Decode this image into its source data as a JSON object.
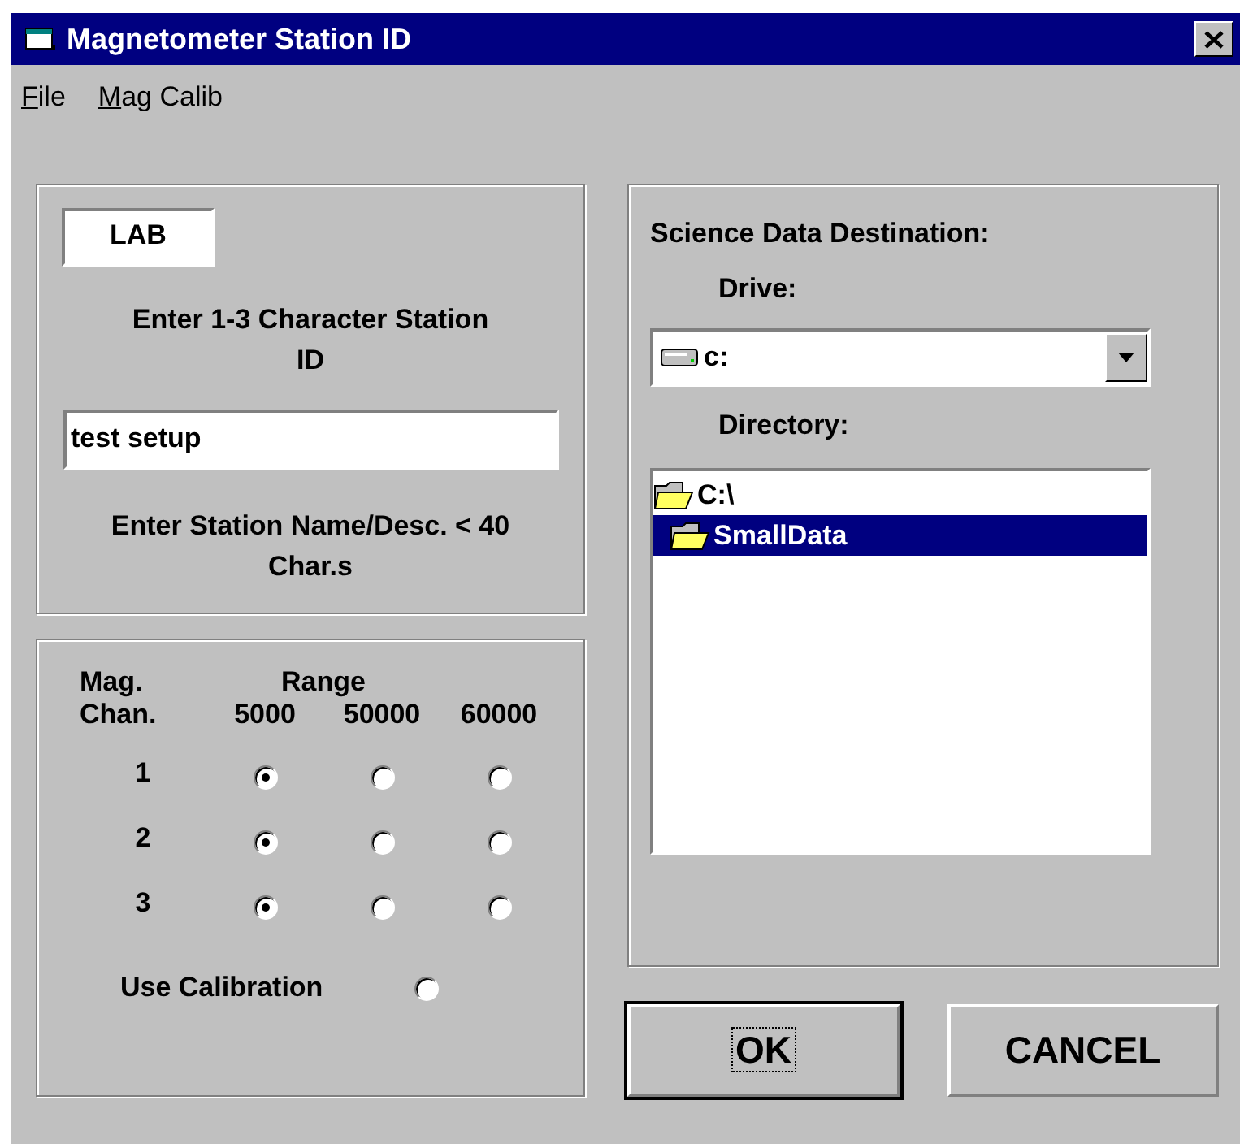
{
  "window": {
    "title": "Magnetometer Station ID"
  },
  "menu": [
    {
      "label": "File"
    },
    {
      "label": "Mag Calib"
    }
  ],
  "station": {
    "id_value": "LAB",
    "id_label": "Enter 1-3 Character Station ID",
    "name_value": "test setup",
    "name_label": "Enter Station Name/Desc. < 40 Char.s"
  },
  "ranges": {
    "channel_header": [
      "Mag.",
      "Chan."
    ],
    "range_header": "Range",
    "columns": [
      "5000",
      "50000",
      "60000"
    ],
    "channels": [
      {
        "label": "1",
        "options": [
          {
            "selected": true
          },
          {
            "selected": false
          },
          {
            "selected": false
          }
        ]
      },
      {
        "label": "2",
        "options": [
          {
            "selected": true
          },
          {
            "selected": false
          },
          {
            "selected": false
          }
        ]
      },
      {
        "label": "3",
        "options": [
          {
            "selected": true
          },
          {
            "selected": false
          },
          {
            "selected": false
          }
        ]
      }
    ],
    "use_calibration": {
      "label": "Use Calibration",
      "checked": false
    }
  },
  "destination": {
    "title": "Science Data Destination:",
    "drive_label": "Drive:",
    "drive": "c:",
    "directory_label": "Directory:",
    "directories": [
      {
        "name": "C:\\",
        "selected": false,
        "children": [
          {
            "name": "SmallData",
            "selected": true
          }
        ]
      }
    ]
  },
  "buttons": [
    {
      "label": "OK",
      "default": true
    },
    {
      "label": "CANCEL",
      "default": false
    }
  ]
}
